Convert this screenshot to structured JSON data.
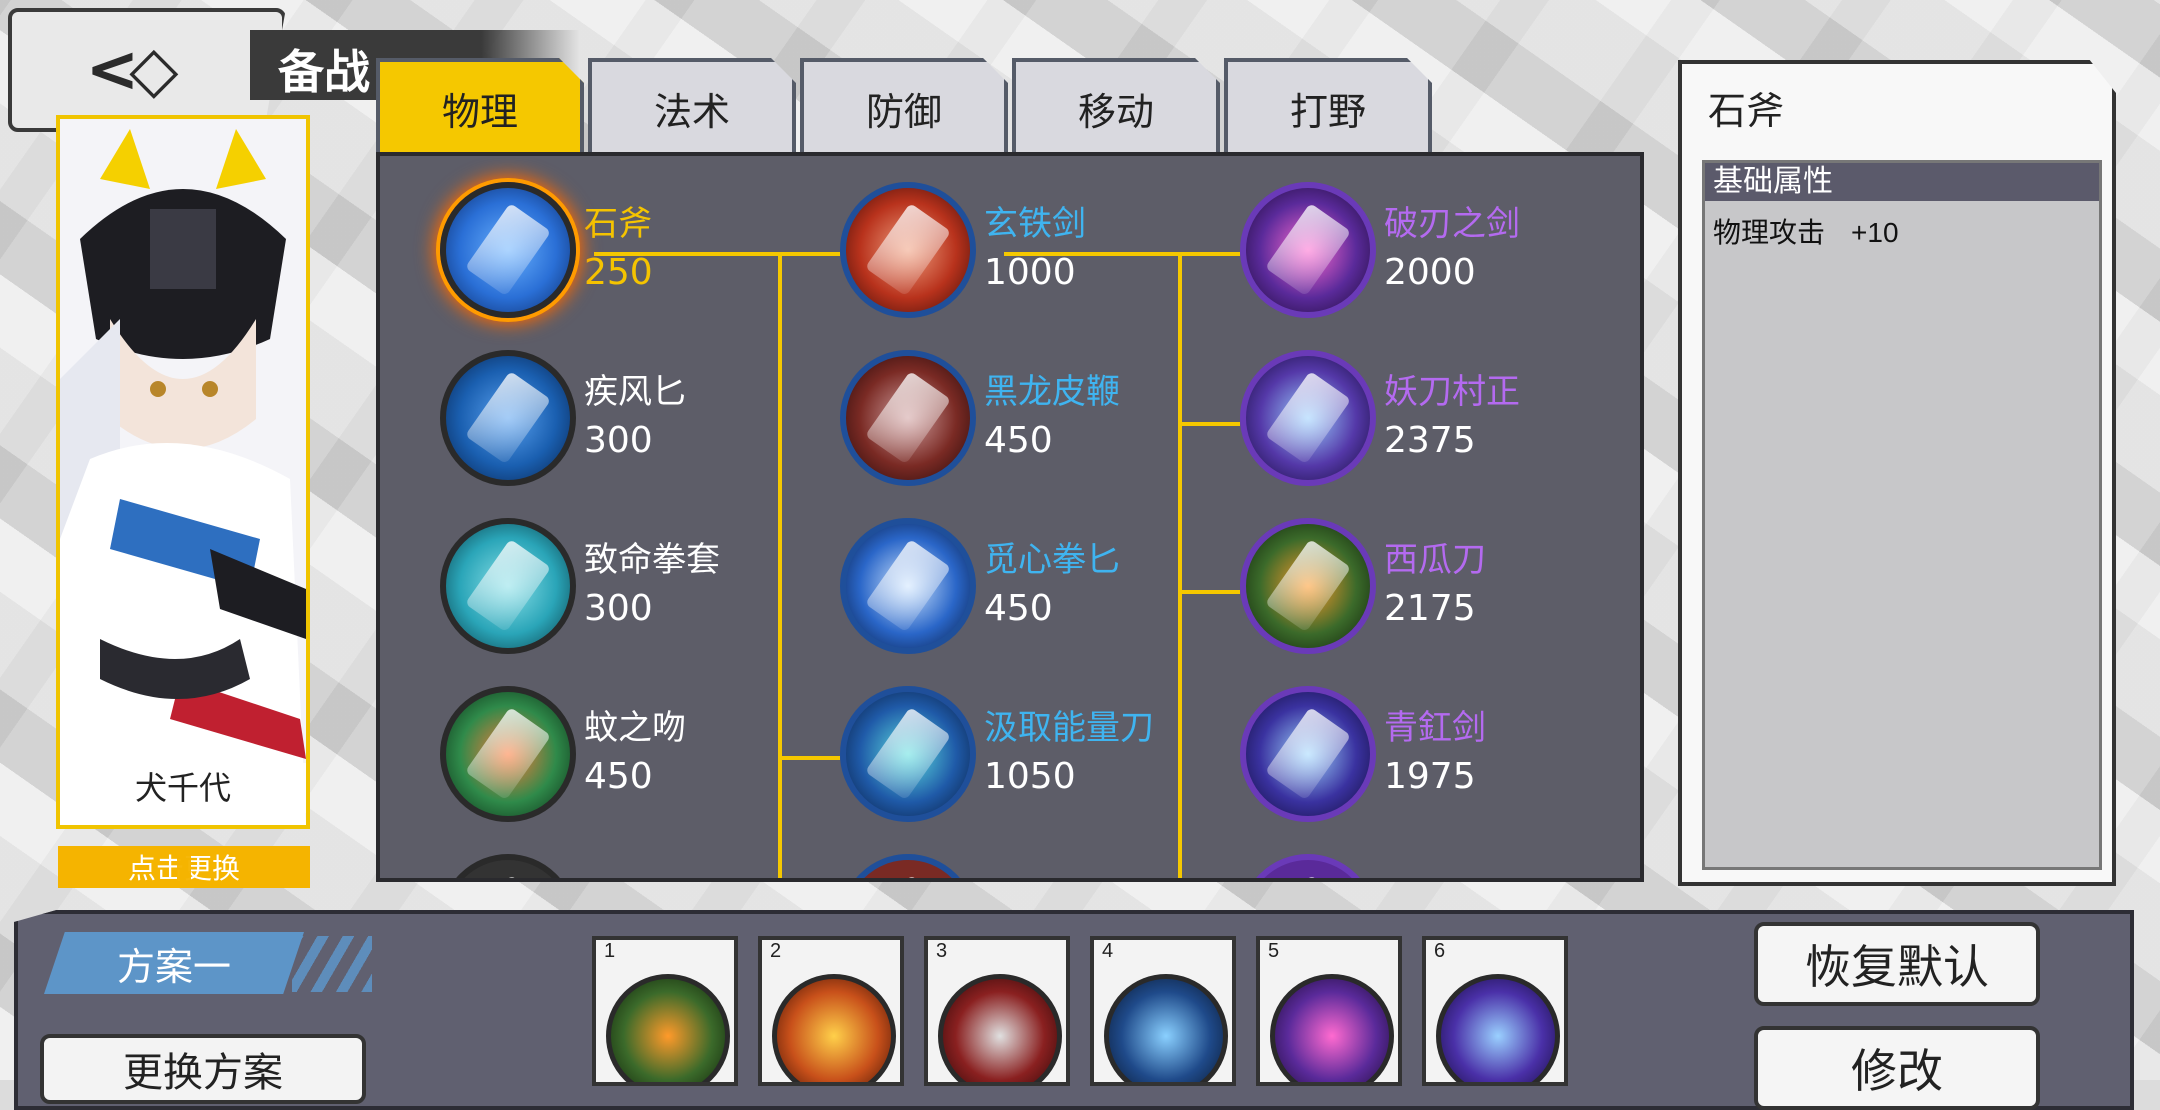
{
  "header": {
    "title": "备战"
  },
  "hero": {
    "name": "犬千代",
    "change_label": "点击更换"
  },
  "tabs": [
    {
      "label": "物理",
      "active": true
    },
    {
      "label": "法术",
      "active": false
    },
    {
      "label": "防御",
      "active": false
    },
    {
      "label": "移动",
      "active": false
    },
    {
      "label": "打野",
      "active": false
    }
  ],
  "items": [
    {
      "name": "石斧",
      "price": "250",
      "color": "#f5c400",
      "icon_color": "#2a6fd6",
      "icon": "stone-axe-icon",
      "selected": true
    },
    {
      "name": "疾风匕",
      "price": "300",
      "color": "#ffffff",
      "icon_color": "#1a5fb0",
      "icon": "gale-dagger-icon"
    },
    {
      "name": "致命拳套",
      "price": "300",
      "color": "#ffffff",
      "icon_color": "#2aa5b8",
      "icon": "deadly-gauntlet-icon"
    },
    {
      "name": "蚊之吻",
      "price": "450",
      "color": "#ffffff",
      "icon_color": "#2f8a4a",
      "icon": "mosquito-kiss-icon"
    },
    {
      "name": "玄铁剑",
      "price": "1000",
      "color": "#3fb4f0",
      "icon_color": "#b8321c",
      "icon": "black-iron-sword-icon"
    },
    {
      "name": "黑龙皮鞭",
      "price": "450",
      "color": "#3fb4f0",
      "icon_color": "#7a2a24",
      "icon": "black-dragon-whip-icon"
    },
    {
      "name": "觅心拳匕",
      "price": "450",
      "color": "#3fb4f0",
      "icon_color": "#2a66c8",
      "icon": "heart-seeker-dagger-icon"
    },
    {
      "name": "汲取能量刀",
      "price": "1050",
      "color": "#3fb4f0",
      "icon_color": "#1f5aa8",
      "icon": "energy-drain-blade-icon"
    },
    {
      "name": "破刃之剑",
      "price": "2000",
      "color": "#b46af0",
      "icon_color": "#5a2a9a",
      "icon": "broken-blade-sword-icon"
    },
    {
      "name": "妖刀村正",
      "price": "2375",
      "color": "#b46af0",
      "icon_color": "#5438a8",
      "icon": "muramasa-blade-icon"
    },
    {
      "name": "西瓜刀",
      "price": "2175",
      "color": "#b46af0",
      "icon_color": "#3b6a2a",
      "icon": "watermelon-knife-icon"
    },
    {
      "name": "青釭剑",
      "price": "1975",
      "color": "#b46af0",
      "icon_color": "#3a32a0",
      "icon": "qinggang-sword-icon"
    }
  ],
  "detail": {
    "title": "石斧",
    "section": "基础属性",
    "stat_label": "物理攻击",
    "stat_value": "+10"
  },
  "plan": {
    "name": "方案一",
    "switch_label": "更换方案"
  },
  "slots": [
    {
      "num": "1",
      "icon_color": "#3b6a2a",
      "icon": "watermelon-knife-icon"
    },
    {
      "num": "2",
      "icon_color": "#c8501a",
      "icon": "fire-boots-icon"
    },
    {
      "num": "3",
      "icon_color": "#8a2020",
      "icon": "crimson-blade-icon"
    },
    {
      "num": "4",
      "icon_color": "#1f4a8a",
      "icon": "steel-armor-icon"
    },
    {
      "num": "5",
      "icon_color": "#5a2a9a",
      "icon": "broken-blade-sword-icon"
    },
    {
      "num": "6",
      "icon_color": "#4a30a8",
      "icon": "muramasa-blade-icon"
    }
  ],
  "actions": {
    "restore": "恢复默认",
    "modify": "修改"
  }
}
